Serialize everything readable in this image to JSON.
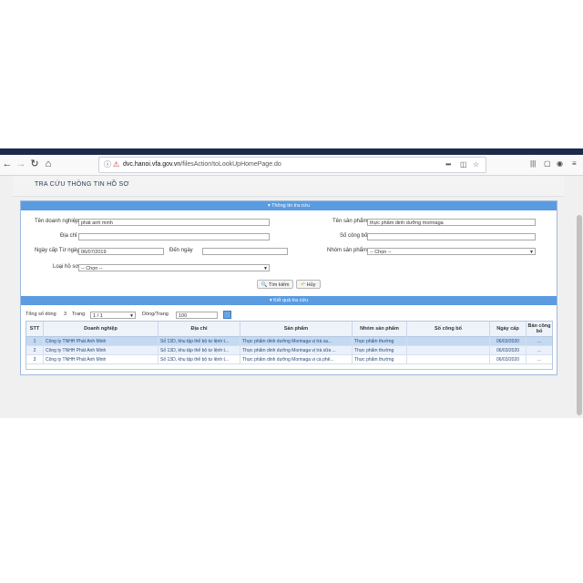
{
  "browser": {
    "url_domain": "dvc.hanoi.vfa.gov.vn",
    "url_path": "/filesAction!toLookUpHomePage.do",
    "menu_dots": "•••"
  },
  "page": {
    "title": "TRA CỨU THÔNG TIN HỒ SƠ"
  },
  "search": {
    "section_title": "Thông tin tra cứu",
    "labels": {
      "company": "Tên doanh nghiệp",
      "product": "Tên sản phẩm",
      "address": "Địa chỉ",
      "announce_no": "Số công bố",
      "date_from": "Ngày cấp Từ ngày",
      "date_to": "Đến ngày",
      "product_group": "Nhóm sản phẩm",
      "file_type": "Loại hồ sơ"
    },
    "values": {
      "company": "phát anh minh",
      "product": "thực phẩm dinh dưỡng morinaga",
      "address": "",
      "announce_no": "",
      "date_from": "06/07/2019",
      "date_to": "",
      "product_group": "-- Chọn --",
      "file_type": "-- Chọn --"
    },
    "search_button": "Tìm kiếm",
    "cancel_button": "Hủy"
  },
  "results": {
    "section_title": "Kết quả tra cứu",
    "total_label": "Tổng số dòng",
    "total_value": "3",
    "page_label": "Trang",
    "page_value": "1 / 1",
    "rows_per_page_label": "Dòng/Trang",
    "rows_per_page_value": "100",
    "columns": [
      "STT",
      "Doanh nghiệp",
      "Địa chỉ",
      "Sản phẩm",
      "Nhóm sản phẩm",
      "Số công bố",
      "Ngày cấp",
      "Bản công bố"
    ],
    "rows": [
      {
        "stt": "1",
        "company": "Công ty TNHH Phát Anh Minh",
        "address": "Số 13D, khu tập thể bộ tư lệnh t...",
        "product": "Thực phẩm dinh dưỡng Morinaga vị trà xa...",
        "group": "Thực phẩm thường",
        "announce_no": "",
        "date": "06/03/2020",
        "doc": "..."
      },
      {
        "stt": "2",
        "company": "Công ty TNHH Phát Anh Minh",
        "address": "Số 13D, khu tập thể bộ tư lệnh t...",
        "product": "Thực phẩm dinh dưỡng Morinaga vị trà sữa ...",
        "group": "Thực phẩm thường",
        "announce_no": "",
        "date": "06/03/2020",
        "doc": "..."
      },
      {
        "stt": "3",
        "company": "Công ty TNHH Phát Anh Minh",
        "address": "Số 13D, khu tập thể bộ tư lệnh t...",
        "product": "Thực phẩm dinh dưỡng Morinaga vị cà phê...",
        "group": "Thực phẩm thường",
        "announce_no": "",
        "date": "06/03/2020",
        "doc": "..."
      }
    ]
  },
  "colors": {
    "section_header": "#5b9be0",
    "selected_row": "#c4d9f2",
    "alt_row": "#eaf1fa",
    "link_text": "#2a4a7a"
  }
}
